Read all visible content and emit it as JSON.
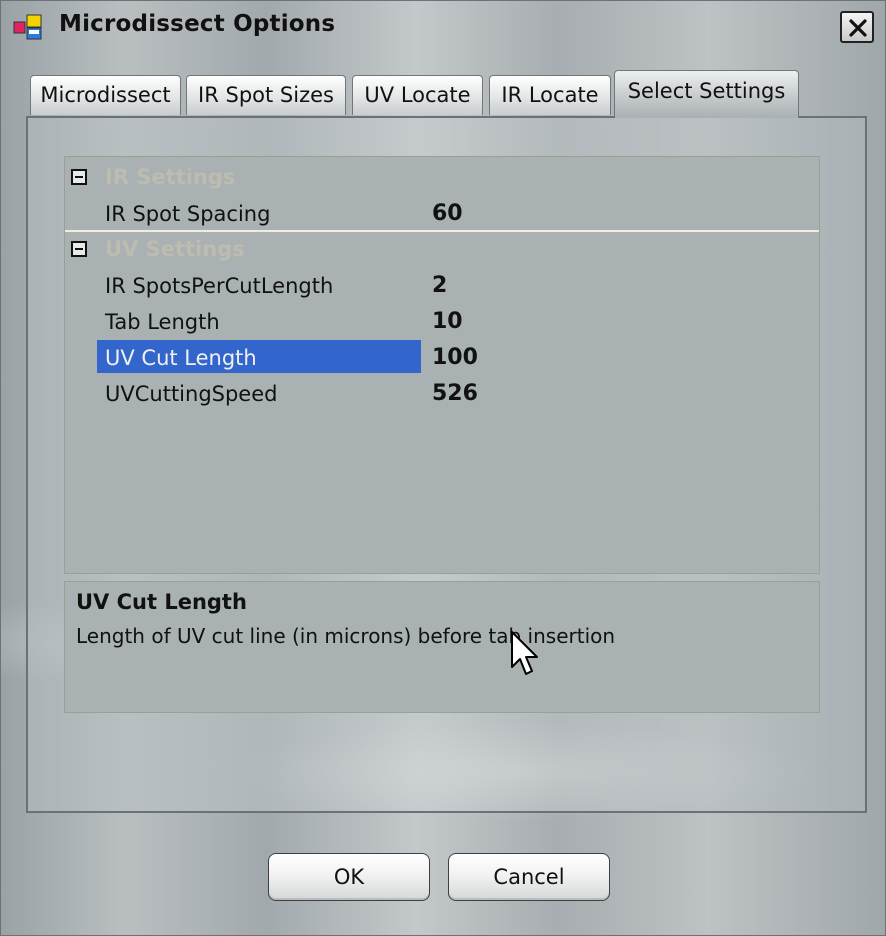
{
  "window": {
    "title": "Microdissect Options",
    "icon": "app-window-icon",
    "close_icon": "close-icon"
  },
  "tabs": [
    {
      "label": "Microdissect",
      "active": false
    },
    {
      "label": "IR Spot Sizes",
      "active": false
    },
    {
      "label": "UV Locate",
      "active": false
    },
    {
      "label": "IR Locate",
      "active": false
    },
    {
      "label": "Select Settings",
      "active": true
    }
  ],
  "property_grid": {
    "categories": [
      {
        "name": "IR Settings",
        "expanded": true,
        "properties": [
          {
            "name": "IR Spot Spacing",
            "value": "60"
          }
        ]
      },
      {
        "name": "UV Settings",
        "expanded": true,
        "properties": [
          {
            "name": "IR SpotsPerCutLength",
            "value": "2"
          },
          {
            "name": "Tab Length",
            "value": "10"
          },
          {
            "name": "UV Cut Length",
            "value": "100",
            "selected": true
          },
          {
            "name": "UVCuttingSpeed",
            "value": "526"
          }
        ]
      }
    ],
    "selection_color": "#3366cc"
  },
  "help": {
    "title": "UV Cut Length",
    "description": "Length of UV cut line (in microns) before tab insertion"
  },
  "buttons": {
    "ok": "OK",
    "cancel": "Cancel"
  }
}
